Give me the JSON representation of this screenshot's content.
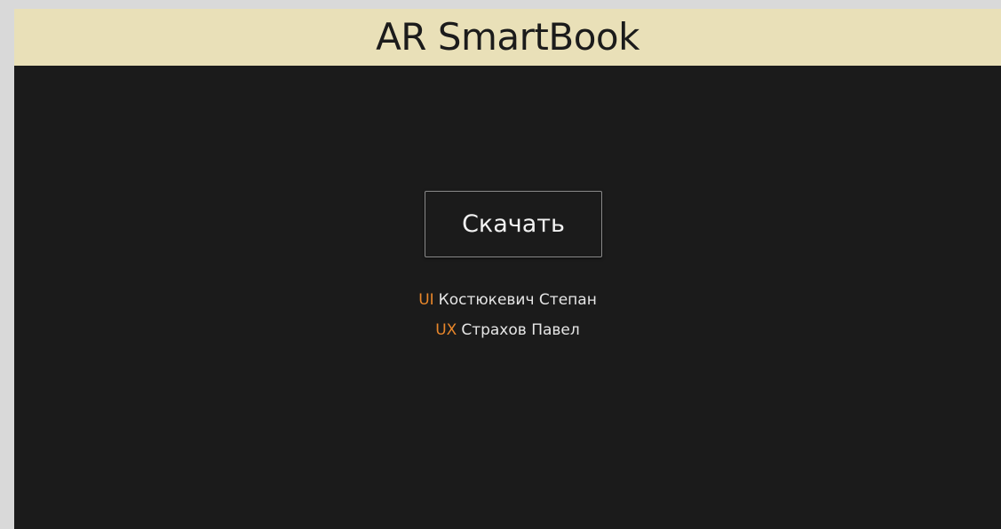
{
  "header": {
    "title": "AR SmartBook"
  },
  "main": {
    "download_label": "Скачать",
    "credits": [
      {
        "role": "UI",
        "name": "Костюкевич Степан"
      },
      {
        "role": "UX",
        "name": "Страхов Павел"
      }
    ]
  },
  "colors": {
    "header_bg": "#e9e0b8",
    "page_bg": "#1b1b1b",
    "accent": "#e8862a",
    "text": "#e6e6e6"
  }
}
